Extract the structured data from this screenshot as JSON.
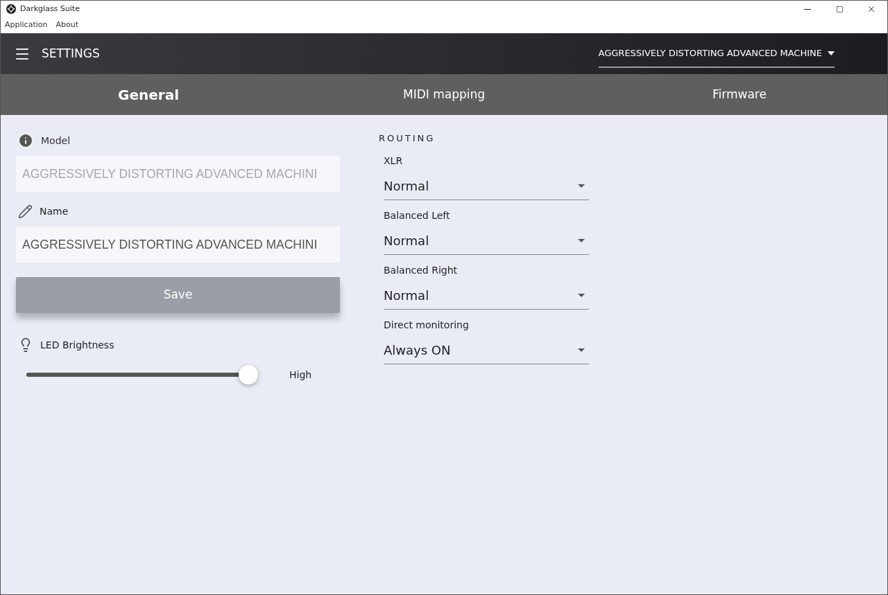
{
  "window": {
    "title": "Darkglass Suite"
  },
  "menu": [
    "Application",
    "About"
  ],
  "header": {
    "title": "SETTINGS",
    "device": "AGGRESSIVELY DISTORTING ADVANCED MACHINE"
  },
  "tabs": [
    {
      "label": "General",
      "selected": true
    },
    {
      "label": "MIDI mapping",
      "selected": false
    },
    {
      "label": "Firmware",
      "selected": false
    }
  ],
  "model": {
    "label": "Model",
    "value": "AGGRESSIVELY DISTORTING ADVANCED MACHINI",
    "disabled": true
  },
  "name": {
    "label": "Name",
    "value": "AGGRESSIVELY DISTORTING ADVANCED MACHINI",
    "disabled": false
  },
  "save_button": "Save",
  "led": {
    "label": "LED Brightness",
    "level": 1,
    "reading": "High"
  },
  "routing": {
    "title": "ROUTING",
    "selects": [
      {
        "label": "XLR",
        "value": "Normal"
      },
      {
        "label": "Balanced Left",
        "value": "Normal"
      },
      {
        "label": "Balanced Right",
        "value": "Normal"
      },
      {
        "label": "Direct monitoring",
        "value": "Always ON"
      }
    ]
  }
}
